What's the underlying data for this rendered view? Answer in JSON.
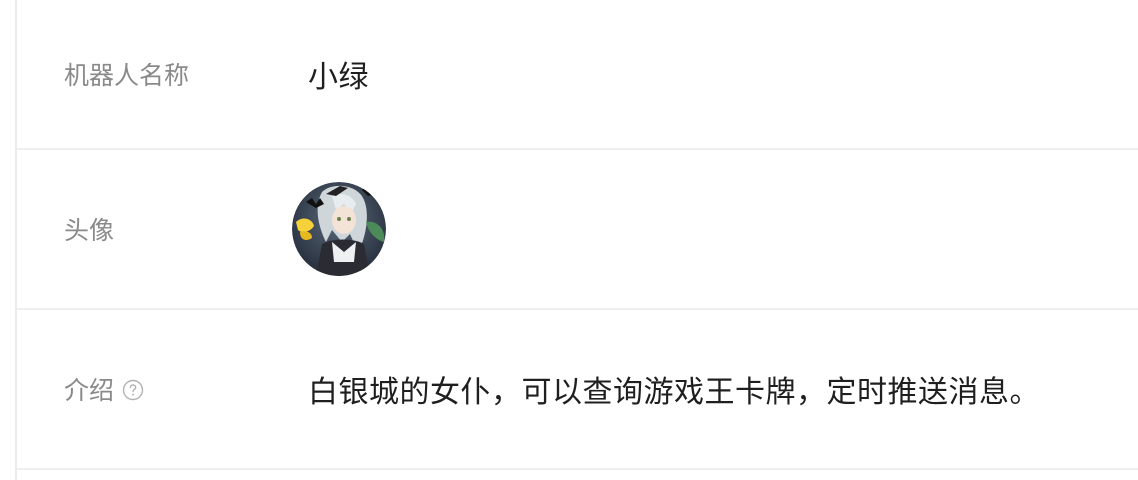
{
  "fields": {
    "name": {
      "label": "机器人名称",
      "value": "小绿"
    },
    "avatar": {
      "label": "头像",
      "alt": "avatar"
    },
    "intro": {
      "label": "介绍",
      "value": "白银城的女仆，可以查询游戏王卡牌，定时推送消息。",
      "help_icon": "question-circle-icon"
    }
  },
  "colors": {
    "label": "#8a8a8a",
    "value": "#1f1f1f",
    "divider": "#efefef"
  }
}
